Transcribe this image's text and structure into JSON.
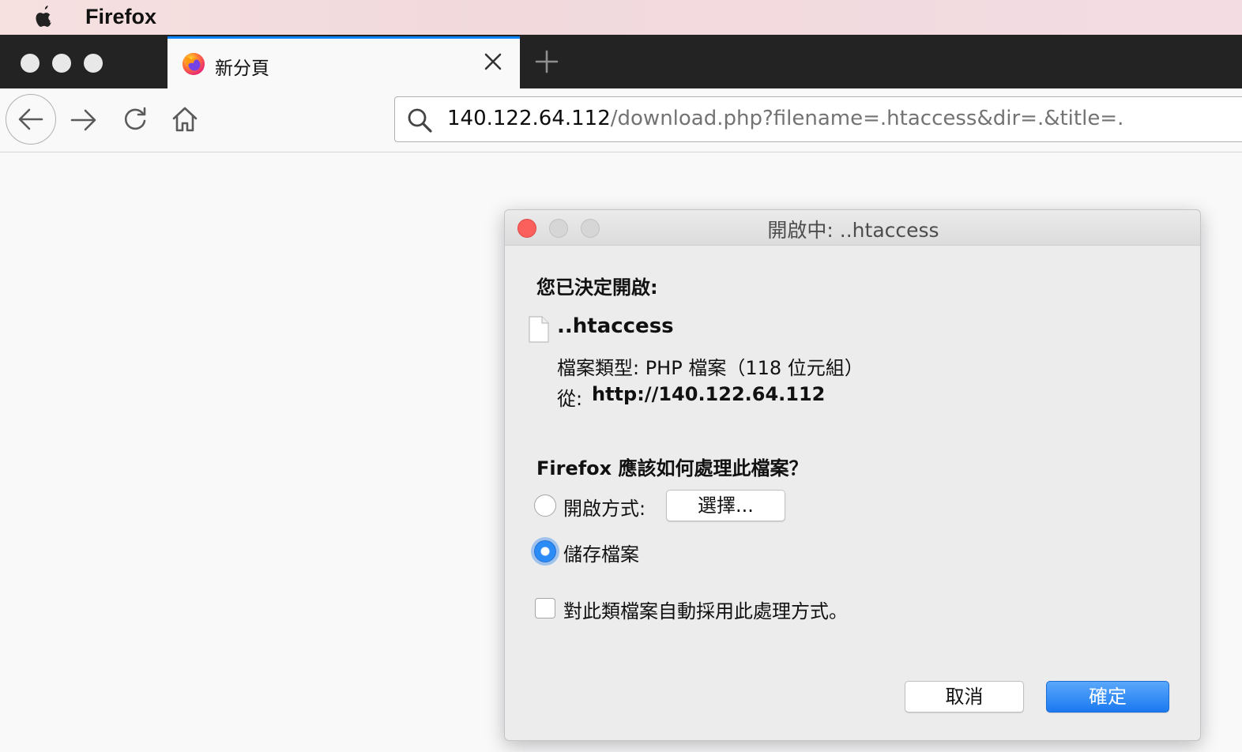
{
  "menubar": {
    "app_name": "Firefox"
  },
  "tab": {
    "title": "新分頁"
  },
  "urlbar": {
    "host": "140.122.64.112",
    "path": "/download.php?filename=.htaccess&dir=.&title=."
  },
  "dialog": {
    "title": "開啟中: ..htaccess",
    "intro": "您已決定開啟:",
    "filename": "..htaccess",
    "filetype": "檔案類型: PHP 檔案（118 位元組）",
    "from_label": "從:",
    "from_url": "http://140.122.64.112",
    "question": "Firefox 應該如何處理此檔案？",
    "open_with_label": "開啟方式:",
    "choose_button": "選擇...",
    "save_file_label": "儲存檔案",
    "selected_option": "save_file",
    "auto_checkbox_label": "對此類檔案自動採用此處理方式。",
    "auto_checked": false,
    "cancel_button": "取消",
    "ok_button": "確定"
  },
  "colors": {
    "accent": "#0a84ff",
    "primary_button": "#1b79f0",
    "close_traffic_light": "#fc605c"
  }
}
